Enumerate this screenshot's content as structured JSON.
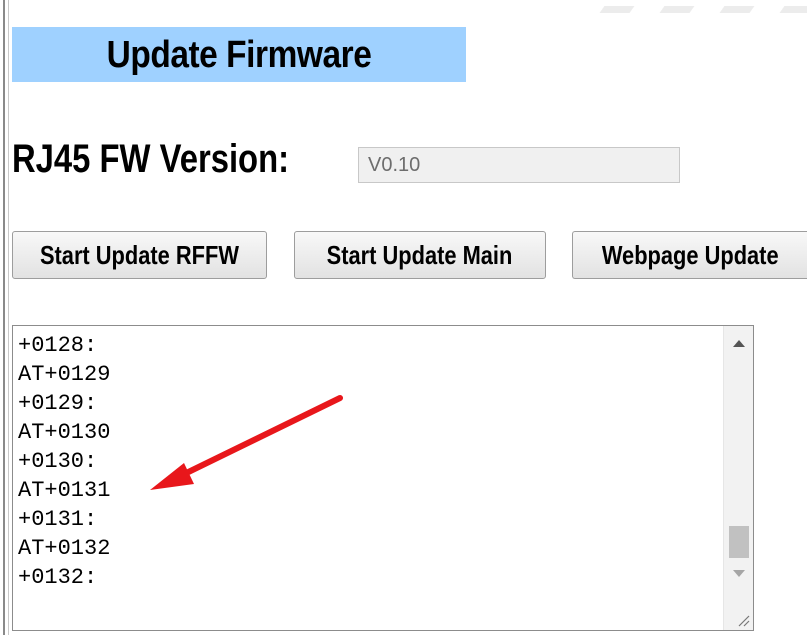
{
  "page": {
    "title": "Update Firmware"
  },
  "version": {
    "label": "RJ45 FW Version:",
    "value": "V0.10"
  },
  "buttons": {
    "rffw": "Start Update RFFW",
    "main": "Start Update Main",
    "webpage": "Webpage Update"
  },
  "log": {
    "lines": [
      "+0128:",
      "AT+0129",
      "+0129:",
      "AT+0130",
      "+0130:",
      "AT+0131",
      "+0131:",
      "AT+0132",
      "+0132:"
    ]
  },
  "annotation": {
    "arrow_color": "#e8171b"
  },
  "colors": {
    "banner": "#9fd1ff"
  }
}
